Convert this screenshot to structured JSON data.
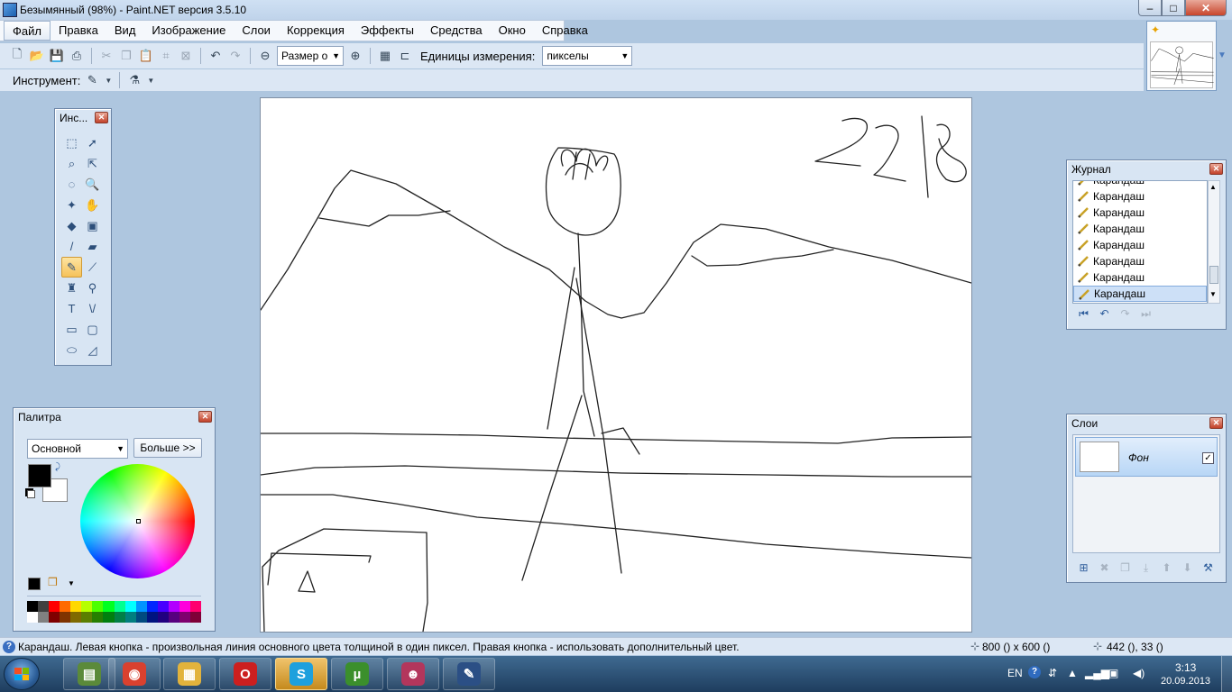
{
  "window": {
    "title": "Безымянный (98%) - Paint.NET версия 3.5.10",
    "min_label": "–",
    "max_label": "□",
    "close_label": "✕"
  },
  "menu": [
    "Файл",
    "Правка",
    "Вид",
    "Изображение",
    "Слои",
    "Коррекция",
    "Эффекты",
    "Средства",
    "Окно",
    "Справка"
  ],
  "toolbar": {
    "zoom_combo": "Размер о",
    "units_label": "Единицы измерения:",
    "units_value": "пикселы",
    "tool_label": "Инструмент:"
  },
  "tools_panel": {
    "title": "Инс...",
    "tools": [
      {
        "icon": "rectangle-select-icon",
        "glyph": "⬚"
      },
      {
        "icon": "move-selection-icon",
        "glyph": "➚"
      },
      {
        "icon": "lasso-select-icon",
        "glyph": "⌕"
      },
      {
        "icon": "move-selected-icon",
        "glyph": "⇱"
      },
      {
        "icon": "ellipse-select-icon",
        "glyph": "◌"
      },
      {
        "icon": "zoom-icon",
        "glyph": "🔍"
      },
      {
        "icon": "magic-wand-icon",
        "glyph": "✦"
      },
      {
        "icon": "pan-icon",
        "glyph": "✋"
      },
      {
        "icon": "paint-bucket-icon",
        "glyph": "◆"
      },
      {
        "icon": "gradient-icon",
        "glyph": "▣"
      },
      {
        "icon": "paintbrush-icon",
        "glyph": "/"
      },
      {
        "icon": "eraser-icon",
        "glyph": "▰"
      },
      {
        "icon": "pencil-icon",
        "glyph": "✎"
      },
      {
        "icon": "color-picker-icon",
        "glyph": "⟋"
      },
      {
        "icon": "clone-stamp-icon",
        "glyph": "♜"
      },
      {
        "icon": "recolor-icon",
        "glyph": "⚲"
      },
      {
        "icon": "text-icon",
        "glyph": "T"
      },
      {
        "icon": "line-curve-icon",
        "glyph": "\\/"
      },
      {
        "icon": "rectangle-icon",
        "glyph": "▭"
      },
      {
        "icon": "rounded-rectangle-icon",
        "glyph": "▢"
      },
      {
        "icon": "ellipse-icon",
        "glyph": "⬭"
      },
      {
        "icon": "freeform-shape-icon",
        "glyph": "◿"
      }
    ]
  },
  "history_panel": {
    "title": "Журнал",
    "items": [
      "Карандаш",
      "Карандаш",
      "Карандаш",
      "Карандаш",
      "Карандаш",
      "Карандаш",
      "Карандаш",
      "Карандаш"
    ]
  },
  "layers_panel": {
    "title": "Слои",
    "layer_name": "Фон",
    "layer_visible_mark": "✓"
  },
  "palette_panel": {
    "title": "Палитра",
    "combo": "Основной",
    "more_button": "Больше >>",
    "primary_color": "#000000",
    "secondary_color": "#ffffff",
    "swatches_top": [
      "#000000",
      "#404040",
      "#ff0000",
      "#ff6a00",
      "#ffd800",
      "#b6ff00",
      "#4cff00",
      "#00ff21",
      "#00ff90",
      "#00ffff",
      "#0094ff",
      "#0026ff",
      "#4800ff",
      "#b200ff",
      "#ff00dc",
      "#ff006e"
    ],
    "swatches_bottom": [
      "#ffffff",
      "#808080",
      "#7f0000",
      "#7f3300",
      "#7f6a00",
      "#5b7f00",
      "#267f00",
      "#007f0e",
      "#007f46",
      "#007f7f",
      "#004a7f",
      "#00137f",
      "#21007f",
      "#57007f",
      "#7f006e",
      "#7f0037"
    ]
  },
  "statusbar": {
    "help_icon": "?",
    "text": "Карандаш. Левая кнопка - произвольная линия основного цвета толщиной в один пиксел. Правая кнопка - использовать дополнительный цвет.",
    "image_size": "800 () x 600 ()",
    "cursor_coords": "442 (), 33 ()"
  },
  "taskbar": {
    "apps": [
      {
        "name": "taskbar-app-monitor",
        "glyph": "▤"
      },
      {
        "name": "taskbar-app-chrome",
        "glyph": "◉"
      },
      {
        "name": "taskbar-app-explorer",
        "glyph": "▦"
      },
      {
        "name": "taskbar-app-opera",
        "glyph": "O"
      },
      {
        "name": "taskbar-app-skype",
        "glyph": "S"
      },
      {
        "name": "taskbar-app-utorrent",
        "glyph": "µ"
      },
      {
        "name": "taskbar-app-game",
        "glyph": "☻"
      },
      {
        "name": "taskbar-app-paintnet",
        "glyph": "✎"
      }
    ],
    "lang": "EN",
    "time": "3:13",
    "date": "20.09.2013"
  }
}
